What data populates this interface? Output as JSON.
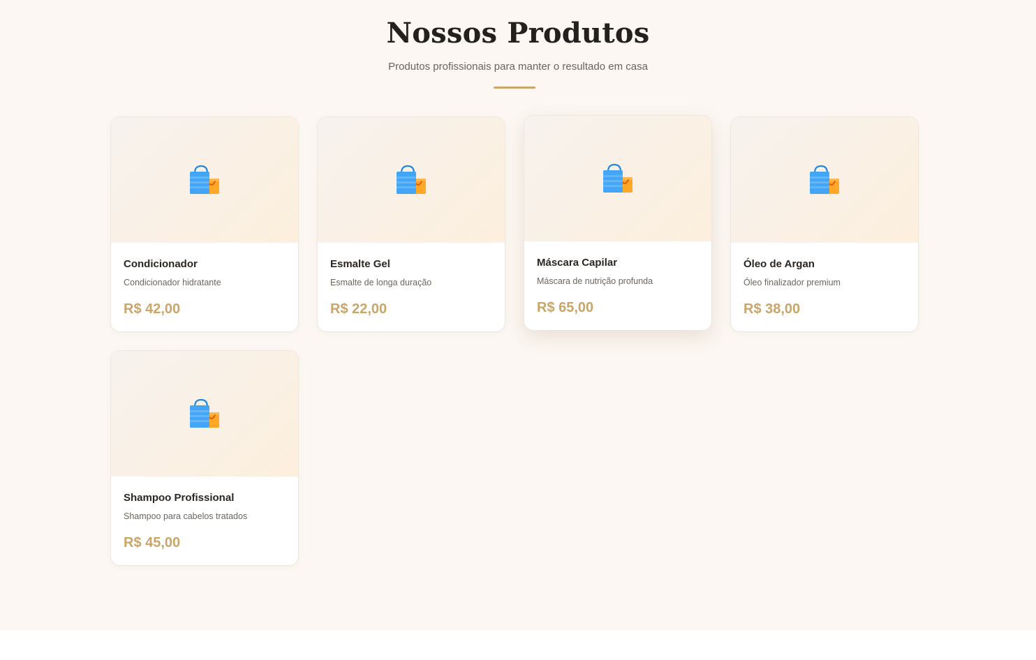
{
  "section": {
    "title": "Nossos Produtos",
    "subtitle": "Produtos profissionais para manter o resultado em casa"
  },
  "colors": {
    "accent": "#c9a56a",
    "background": "#fcf7f2",
    "card_background": "#ffffff",
    "heading": "#23201e"
  },
  "products": [
    {
      "name": "Condicionador",
      "description": "Condicionador hidratante",
      "price": "R$ 42,00",
      "icon": "shopping-bags-icon"
    },
    {
      "name": "Esmalte Gel",
      "description": "Esmalte de longa duração",
      "price": "R$ 22,00",
      "icon": "shopping-bags-icon"
    },
    {
      "name": "Máscara Capilar",
      "description": "Máscara de nutrição profunda",
      "price": "R$ 65,00",
      "icon": "shopping-bags-icon"
    },
    {
      "name": "Óleo de Argan",
      "description": "Óleo finalizador premium",
      "price": "R$ 38,00",
      "icon": "shopping-bags-icon"
    },
    {
      "name": "Shampoo Profissional",
      "description": "Shampoo para cabelos tratados",
      "price": "R$ 45,00",
      "icon": "shopping-bags-icon"
    }
  ]
}
